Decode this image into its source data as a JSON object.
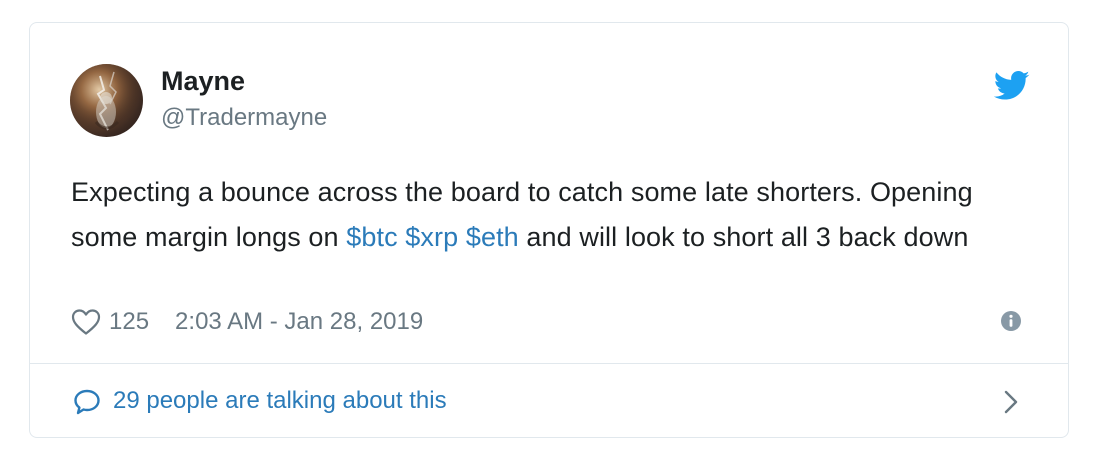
{
  "user": {
    "name": "Mayne",
    "handle": "@Tradermayne",
    "avatar_icon": "profile-avatar"
  },
  "tweet": {
    "text_before": "Expecting a bounce across the board to catch some late shorters. Opening some margin longs on ",
    "cashtags": [
      "$btc",
      "$xrp",
      "$eth"
    ],
    "text_after": " and will look to short all 3 back down"
  },
  "meta": {
    "likes": "125",
    "timestamp": "2:03 AM - Jan 28, 2019",
    "heart_icon": "heart-icon",
    "info_icon": "info-icon"
  },
  "footer": {
    "talking_text": "29 people are talking about this",
    "bubble_icon": "speech-bubble-icon",
    "chevron_icon": "chevron-right-icon"
  },
  "colors": {
    "text": "#1c2022",
    "muted": "#697882",
    "link": "#2b7bb9",
    "twitter_blue": "#1da1f2",
    "border": "#e1e8ed"
  }
}
